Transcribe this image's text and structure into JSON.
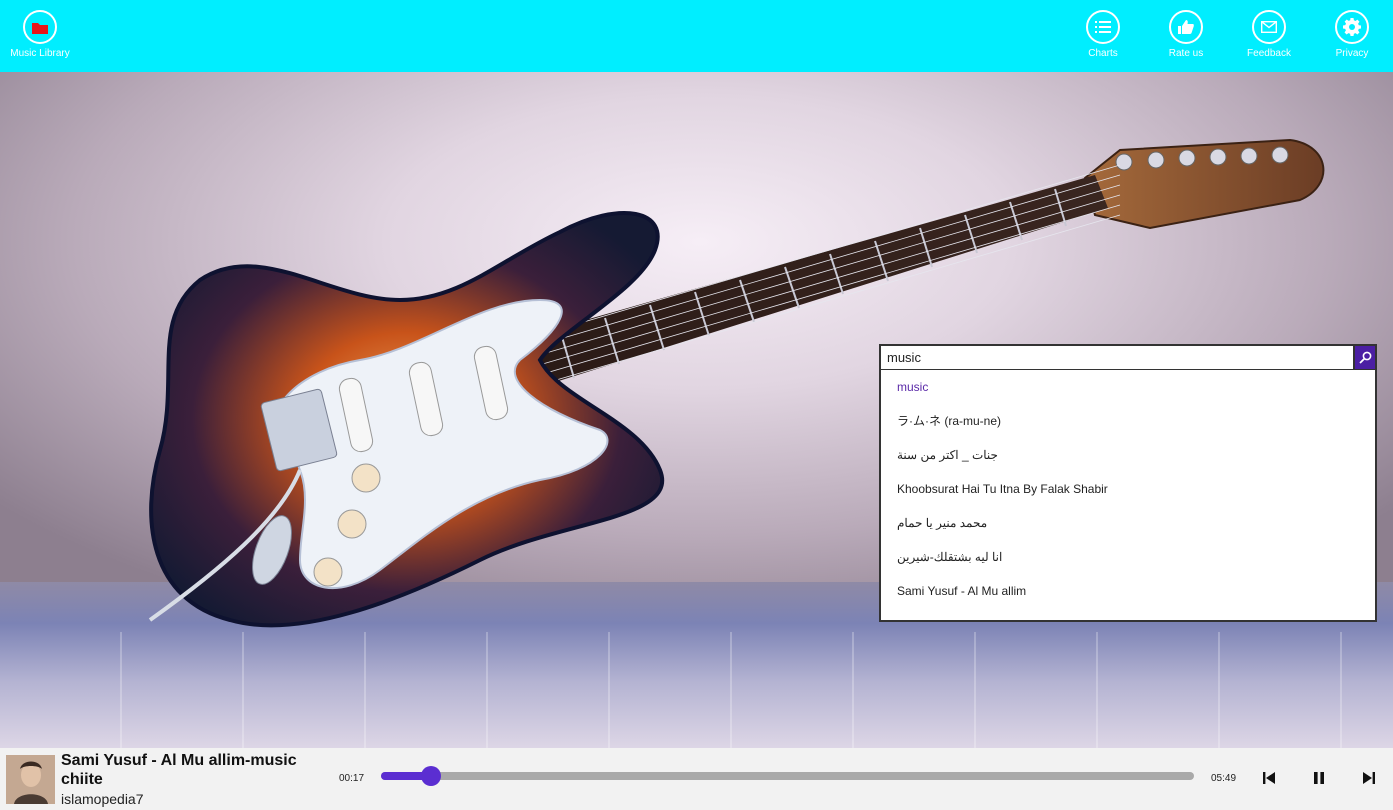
{
  "nav": {
    "library": {
      "label": "Music Library",
      "icon": "folder-icon"
    },
    "charts": {
      "label": "Charts",
      "icon": "list-icon"
    },
    "rate": {
      "label": "Rate us",
      "icon": "thumbs-up-icon"
    },
    "feedback": {
      "label": "Feedback",
      "icon": "mail-icon"
    },
    "privacy": {
      "label": "Privacy",
      "icon": "gear-icon"
    }
  },
  "search": {
    "value": "music",
    "suggestions": [
      "music",
      "ラ·ム·ネ (ra-mu-ne)",
      "جنات _ اكتر من سنة",
      "Khoobsurat Hai Tu Itna By Falak Shabir",
      "محمد منير يا حمام",
      "انا ليه بشتقلك-شيرين",
      "Sami Yusuf - Al Mu allim"
    ]
  },
  "player": {
    "title": "Sami Yusuf - Al Mu allim-music chiite",
    "artist": "islamopedia7",
    "elapsed": "00:17",
    "duration": "05:49",
    "progress": 0.062
  },
  "colors": {
    "topbar": "#00eeff",
    "accent": "#5b2ed1",
    "search_button": "#4b1fa3"
  }
}
